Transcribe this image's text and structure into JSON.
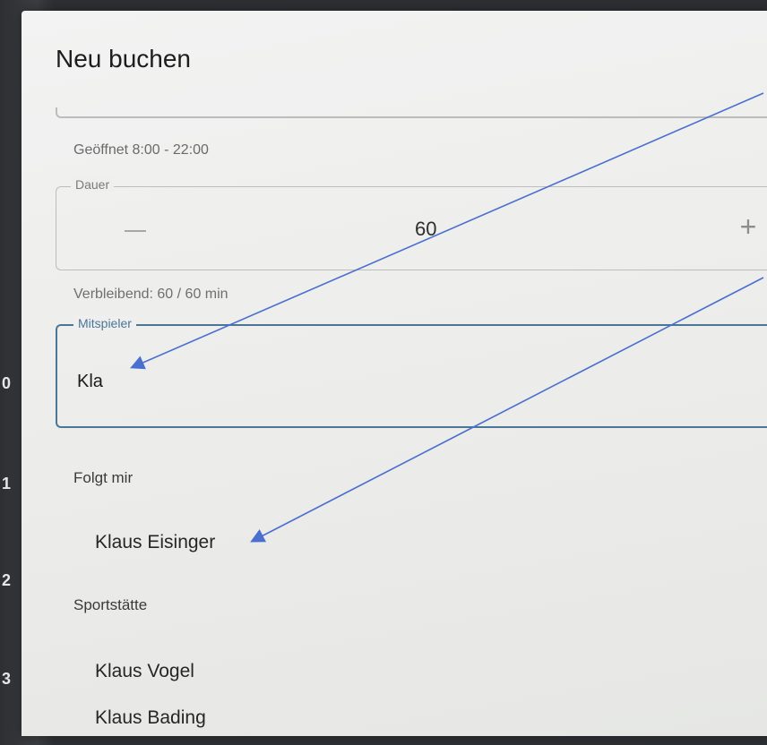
{
  "background": {
    "row_numbers": [
      "0",
      "1",
      "2",
      "3"
    ]
  },
  "dialog": {
    "title": "Neu buchen",
    "opening_hours": "Geöffnet 8:00 - 22:00",
    "duration": {
      "label": "Dauer",
      "value": "60",
      "minus_icon": "minus-icon",
      "plus_symbol": "+"
    },
    "remaining": "Verbleibend: 60 / 60 min",
    "player_field": {
      "label": "Mitspieler",
      "value": "Kla"
    },
    "suggestions": {
      "group1_title": "Folgt mir",
      "group1_items": [
        "Klaus Eisinger"
      ],
      "group2_title": "Sportstätte",
      "group2_items": [
        "Klaus Vogel",
        "Klaus Bading"
      ]
    }
  },
  "colors": {
    "accent": "#4b7695",
    "arrow": "#4a6fcf"
  }
}
